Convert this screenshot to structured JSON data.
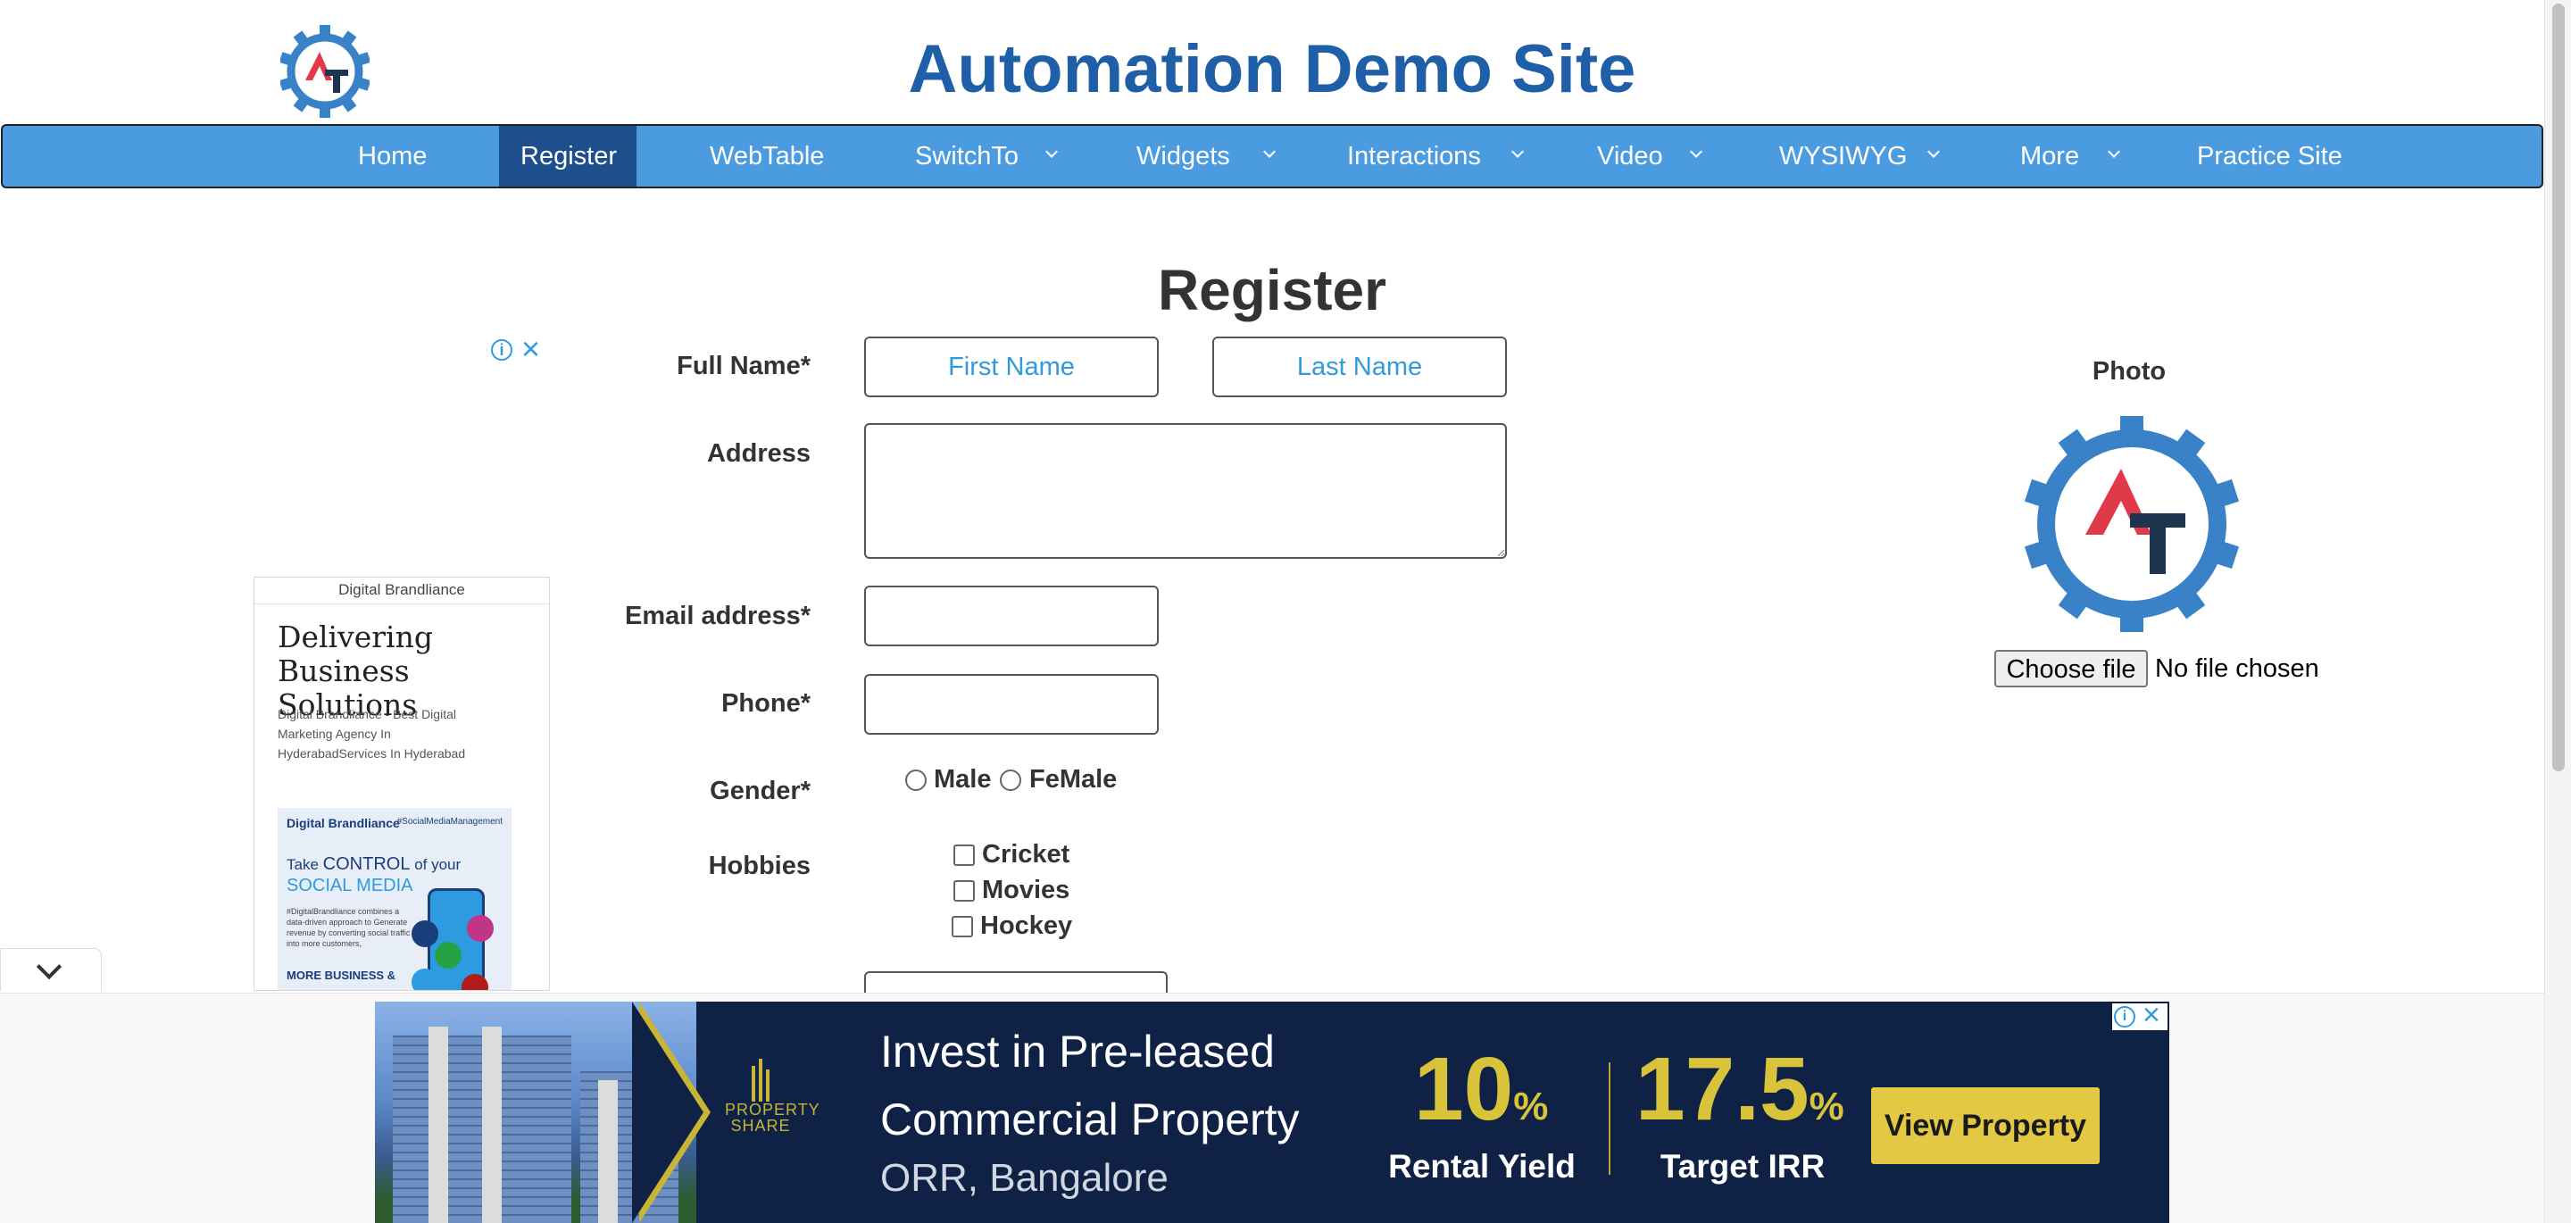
{
  "header": {
    "site_title": "Automation Demo Site"
  },
  "nav": {
    "items": [
      {
        "label": "Home",
        "has_dropdown": false,
        "active": false
      },
      {
        "label": "Register",
        "has_dropdown": false,
        "active": true
      },
      {
        "label": "WebTable",
        "has_dropdown": false,
        "active": false
      },
      {
        "label": "SwitchTo",
        "has_dropdown": true,
        "active": false
      },
      {
        "label": "Widgets",
        "has_dropdown": true,
        "active": false
      },
      {
        "label": "Interactions",
        "has_dropdown": true,
        "active": false
      },
      {
        "label": "Video",
        "has_dropdown": true,
        "active": false
      },
      {
        "label": "WYSIWYG",
        "has_dropdown": true,
        "active": false
      },
      {
        "label": "More",
        "has_dropdown": true,
        "active": false
      },
      {
        "label": "Practice Site",
        "has_dropdown": false,
        "active": false
      }
    ],
    "colors": {
      "bar": "#4a9be0",
      "active": "#1d4f8c"
    }
  },
  "form": {
    "heading": "Register",
    "full_name_label": "Full Name*",
    "first_name_placeholder": "First Name",
    "last_name_placeholder": "Last Name",
    "address_label": "Address",
    "email_label": "Email address*",
    "phone_label": "Phone*",
    "gender_label": "Gender*",
    "gender_options": [
      "Male",
      "FeMale"
    ],
    "hobbies_label": "Hobbies",
    "hobby_options": [
      "Cricket",
      "Movies",
      "Hockey"
    ]
  },
  "photo": {
    "label": "Photo",
    "choose_file_label": "Choose file",
    "file_status": "No file chosen"
  },
  "side_ad": {
    "brand": "Digital Brandliance",
    "headline": "Delivering Business Solutions",
    "description": "Digital Brandliance - Best Digital Marketing Agency In HyderabadServices In Hyderabad",
    "panel_logo": "Digital Brandliance",
    "panel_tag": "#SocialMediaManagement",
    "panel_take": "Take",
    "panel_control": "CONTROL",
    "panel_of_your": "of your",
    "panel_social": "SOCIAL MEDIA",
    "panel_small": "#DigitalBrandliance combines a data-driven approach to Generate revenue by converting social traffic into more customers,",
    "panel_more": "MORE BUSINESS &",
    "info_icon": "info-icon",
    "close_icon": "close-icon"
  },
  "banner_ad": {
    "brand_line1": "PROPERTY",
    "brand_line2": "SHARE",
    "headline_line1": "Invest in Pre-leased",
    "headline_line2": "Commercial Property",
    "headline_line3": "ORR, Bangalore",
    "stat1_value": "10",
    "stat1_unit": "%",
    "stat1_label": "Rental Yield",
    "stat2_value": "17.5",
    "stat2_unit": "%",
    "stat2_label": "Target IRR",
    "cta_label": "View Property",
    "colors": {
      "background": "#0f2245",
      "accent": "#d8c33a",
      "button": "#e3c843"
    }
  }
}
